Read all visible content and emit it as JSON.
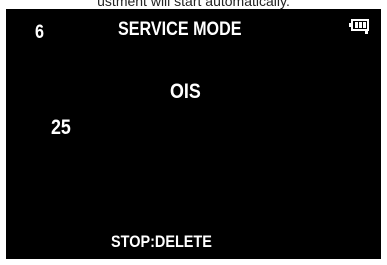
{
  "caption": {
    "text": "ustment will start automatically."
  },
  "screen": {
    "counter_top": "6",
    "title": "SERVICE MODE",
    "ois_label": "OIS",
    "counter_mid": "25",
    "stop_label": "STOP:DELETE"
  },
  "icons": {
    "battery": "battery-icon"
  },
  "colors": {
    "background": "#000000",
    "text": "#ffffff"
  }
}
